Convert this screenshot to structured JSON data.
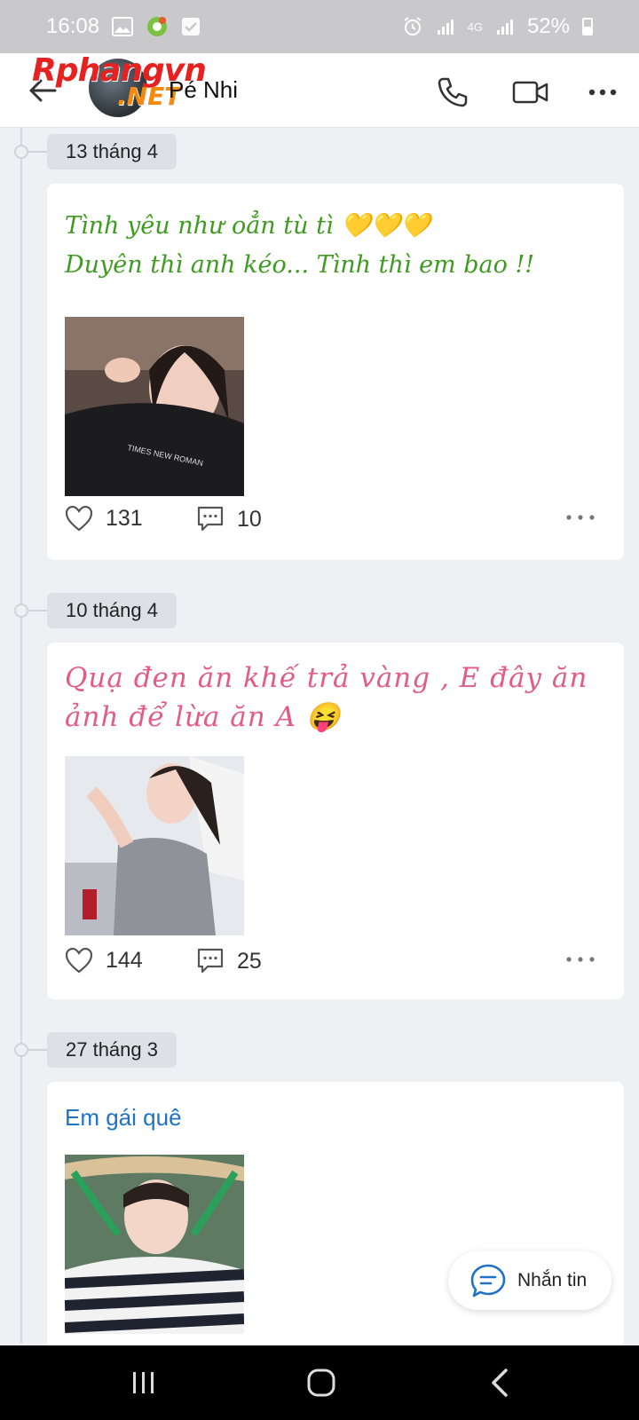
{
  "status_bar": {
    "time": "16:08",
    "network": "4G",
    "battery": "52%",
    "icons": [
      "image-icon",
      "app-icon",
      "check-icon",
      "alarm-icon",
      "signal-icon",
      "battery-icon"
    ]
  },
  "header": {
    "contact_name": "Pé Nhi",
    "watermark_main": "Rphangvn",
    "watermark_sub": ".NET",
    "icons": [
      "back-arrow-icon",
      "phone-icon",
      "video-call-icon",
      "more-icon"
    ]
  },
  "posts": [
    {
      "date": "13 tháng 4",
      "text_lines": [
        "Tình yêu như oẳn tù tì 💛💛💛",
        "Duyên thì anh kéo... Tình thì em bao !!"
      ],
      "text_style": "green-script",
      "likes": "131",
      "comments": "10"
    },
    {
      "date": "10 tháng 4",
      "text_lines": [
        "Quạ đen ăn khế trả vàng , E đây ăn",
        "ảnh để lừa ăn A 😝"
      ],
      "text_style": "pink-script",
      "likes": "144",
      "comments": "25"
    },
    {
      "date": "27 tháng 3",
      "text_lines": [
        "Em gái quê"
      ],
      "text_style": "blue-plain"
    }
  ],
  "message_button": {
    "label": "Nhắn tin"
  },
  "colors": {
    "background": "#eef0f4",
    "green_text": "#3f9b22",
    "pink_text": "#e25c86",
    "blue_text": "#1e73c9",
    "accent_blue": "#1e73c9"
  }
}
